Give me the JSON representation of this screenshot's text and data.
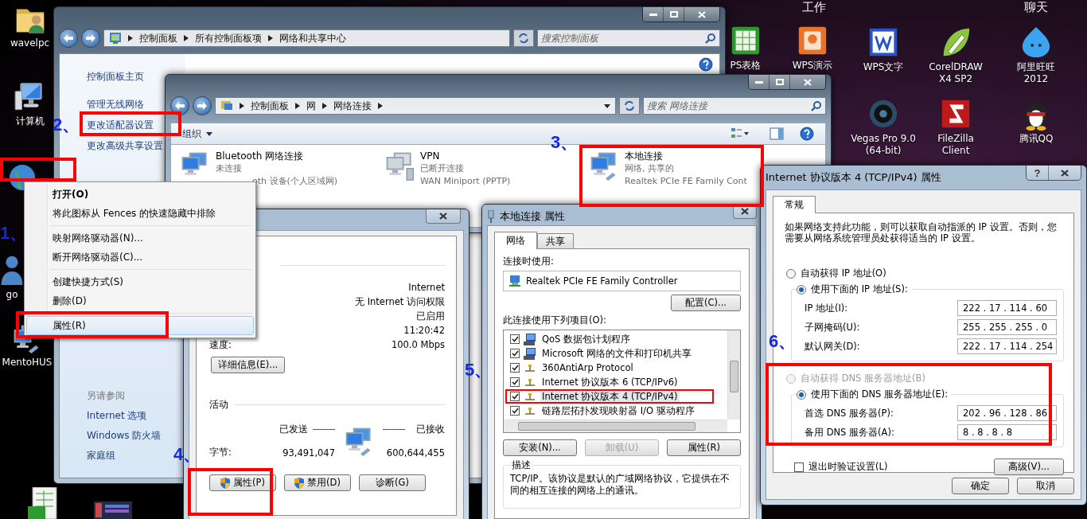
{
  "desktop": {
    "group_labels": [
      "工作",
      "聊天"
    ],
    "icons": [
      {
        "label": "wavelpc",
        "kind": "folder"
      },
      {
        "label": "计算机",
        "kind": "computer"
      },
      {
        "label": "go",
        "kind": "person"
      },
      {
        "label": "MentoHUS",
        "kind": "network"
      },
      {
        "label": "PS表格",
        "kind": "sheet"
      },
      {
        "label": "WPS演示",
        "kind": "slides"
      },
      {
        "label": "WPS文字",
        "kind": "doc"
      },
      {
        "label": "CorelDRAW X4 SP2",
        "kind": "draw"
      },
      {
        "label": "阿里旺旺 2012",
        "kind": "chat"
      },
      {
        "label": "Vegas Pro 9.0 (64-bit)",
        "kind": "video"
      },
      {
        "label": "FileZilla Client",
        "kind": "ftp"
      },
      {
        "label": "腾讯QQ",
        "kind": "penguin"
      }
    ]
  },
  "control_panel_window": {
    "breadcrumb": [
      "控制面板",
      "所有控制面板项",
      "网络和共享中心"
    ],
    "search": {
      "placeholder": "搜索控制面板"
    },
    "tasks": [
      {
        "label": "控制面板主页"
      },
      {
        "label": "管理无线网络"
      },
      {
        "label": "更改适配器设置"
      },
      {
        "label": "更改高级共享设置"
      }
    ],
    "see_also": {
      "heading": "另请参阅",
      "links": [
        "Internet 选项",
        "Windows 防火墙",
        "家庭组"
      ]
    }
  },
  "connections_window": {
    "breadcrumb": [
      "控制面板",
      "网",
      "网络连接"
    ],
    "search": {
      "placeholder": "搜索 网络连接"
    },
    "organize": "组织",
    "connections": [
      {
        "name": "Bluetooth 网络连接",
        "status": "未连接",
        "device": "oth 设备(个人区域网)",
        "kind": "bluetooth"
      },
      {
        "name": "VPN",
        "status": "已断开连接",
        "device": "WAN Miniport (PPTP)",
        "kind": "vpn"
      },
      {
        "name": "本地连接",
        "status": "网络, 共享的",
        "device": "Realtek PCIe FE Family Cont",
        "kind": "lan"
      }
    ]
  },
  "status_dialog": {
    "rows": [
      {
        "value": "Internet"
      },
      {
        "value": "无 Internet 访问权限"
      },
      {
        "value": "已启用"
      },
      {
        "value": "11:20:42"
      },
      {
        "label": "速度:",
        "value": "100.0 Mbps"
      }
    ],
    "details_button": "详细信息(E)...",
    "activity_heading": "活动",
    "sent_label": "已发送",
    "received_label": "已接收",
    "bytes_label": "字节:",
    "bytes_sent": "93,491,047",
    "bytes_received": "600,644,455",
    "buttons": [
      {
        "label": "属性(P)",
        "shield": true
      },
      {
        "label": "禁用(D)",
        "shield": true
      },
      {
        "label": "诊断(G)",
        "shield": false
      }
    ]
  },
  "context_menu": [
    {
      "kind": "default",
      "label": "打开(O)",
      "selected": false
    },
    {
      "kind": "item",
      "label": "将此图标从 Fences 的快速隐藏中排除",
      "selected": false
    },
    {
      "kind": "separator"
    },
    {
      "kind": "item",
      "label": "映射网络驱动器(N)...",
      "selected": false
    },
    {
      "kind": "item",
      "label": "断开网络驱动器(C)...",
      "selected": false
    },
    {
      "kind": "separator"
    },
    {
      "kind": "item",
      "label": "创建快捷方式(S)",
      "selected": false
    },
    {
      "kind": "item",
      "label": "删除(D)",
      "selected": false
    },
    {
      "kind": "separator"
    },
    {
      "kind": "item",
      "label": "属性(R)",
      "selected": true
    }
  ],
  "properties_dialog": {
    "title": "本地连接 属性",
    "tabs": [
      {
        "label": "网络",
        "selected": true
      },
      {
        "label": "共享",
        "selected": false
      }
    ],
    "connect_using_label": "连接时使用:",
    "adapter": "Realtek PCIe FE Family Controller",
    "configure_button": "配置(C)...",
    "items_label": "此连接使用下列项目(O):",
    "items": [
      {
        "label": "QoS 数据包计划程序",
        "checked": true,
        "selected": false,
        "kind": "service"
      },
      {
        "label": "Microsoft 网络的文件和打印机共享",
        "checked": true,
        "selected": false,
        "kind": "service"
      },
      {
        "label": "360AntiArp Protocol",
        "checked": true,
        "selected": false,
        "kind": "protocol"
      },
      {
        "label": "Internet 协议版本 6 (TCP/IPv6)",
        "checked": true,
        "selected": false,
        "kind": "protocol"
      },
      {
        "label": "Internet 协议版本 4 (TCP/IPv4)",
        "checked": true,
        "selected": true,
        "kind": "protocol"
      },
      {
        "label": "链路层拓扑发现映射器 I/O 驱动程序",
        "checked": true,
        "selected": false,
        "kind": "protocol"
      }
    ],
    "buttons": [
      {
        "label": "安装(N)...",
        "disabled": false
      },
      {
        "label": "卸载(U)",
        "disabled": true
      },
      {
        "label": "属性(R)",
        "disabled": false
      }
    ],
    "description_heading": "描述",
    "description": "TCP/IP。该协议是默认的广域网络协议，它提供在不同的相互连接的网络上的通讯。"
  },
  "ipv4_dialog": {
    "title": "Internet 协议版本 4 (TCP/IPv4) 属性",
    "help_button": "?",
    "tabs": [
      {
        "label": "常规",
        "selected": true
      }
    ],
    "intro": "如果网络支持此功能，则可以获取自动指派的 IP 设置。否则，您需要从网络系统管理员处获得适当的 IP 设置。",
    "ip_options": [
      {
        "label": "自动获得 IP 地址(O)",
        "selected": false,
        "disabled": false
      },
      {
        "label": "使用下面的 IP 地址(S):",
        "selected": true,
        "disabled": false
      }
    ],
    "ip_fields": [
      {
        "label": "IP 地址(I):",
        "value": "222 . 17 . 114 . 60"
      },
      {
        "label": "子网掩码(U):",
        "value": "255 . 255 . 255 . 0"
      },
      {
        "label": "默认网关(D):",
        "value": "222 . 17 . 114 . 254"
      }
    ],
    "dns_options": [
      {
        "label": "自动获得 DNS 服务器地址(B)",
        "selected": false,
        "disabled": true
      },
      {
        "label": "使用下面的 DNS 服务器地址(E):",
        "selected": true,
        "disabled": false
      }
    ],
    "dns_fields": [
      {
        "label": "首选 DNS 服务器(P):",
        "value": "202 . 96 . 128 . 86"
      },
      {
        "label": "备用 DNS 服务器(A):",
        "value": "8 . 8 . 8 . 8"
      }
    ],
    "validate_on_exit": {
      "label": "退出时验证设置(L)",
      "checked": false
    },
    "advanced_button": "高级(V)...",
    "footer_buttons": [
      "确定",
      "取消"
    ]
  },
  "steps": [
    "1、",
    "2、",
    "3、",
    "4、",
    "5、",
    "6、"
  ]
}
